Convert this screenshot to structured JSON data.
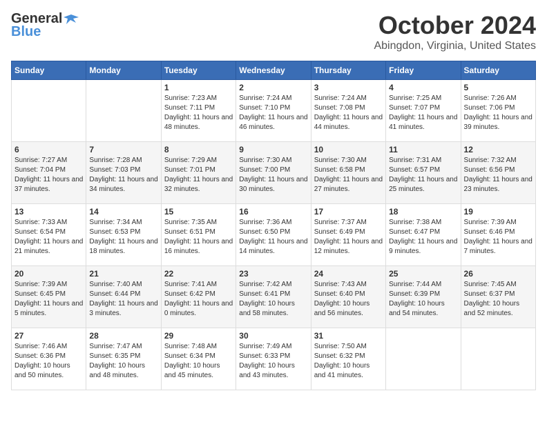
{
  "header": {
    "logo_general": "General",
    "logo_blue": "Blue",
    "month": "October 2024",
    "location": "Abingdon, Virginia, United States"
  },
  "weekdays": [
    "Sunday",
    "Monday",
    "Tuesday",
    "Wednesday",
    "Thursday",
    "Friday",
    "Saturday"
  ],
  "weeks": [
    [
      {
        "day": "",
        "info": ""
      },
      {
        "day": "",
        "info": ""
      },
      {
        "day": "1",
        "info": "Sunrise: 7:23 AM\nSunset: 7:11 PM\nDaylight: 11 hours and 48 minutes."
      },
      {
        "day": "2",
        "info": "Sunrise: 7:24 AM\nSunset: 7:10 PM\nDaylight: 11 hours and 46 minutes."
      },
      {
        "day": "3",
        "info": "Sunrise: 7:24 AM\nSunset: 7:08 PM\nDaylight: 11 hours and 44 minutes."
      },
      {
        "day": "4",
        "info": "Sunrise: 7:25 AM\nSunset: 7:07 PM\nDaylight: 11 hours and 41 minutes."
      },
      {
        "day": "5",
        "info": "Sunrise: 7:26 AM\nSunset: 7:06 PM\nDaylight: 11 hours and 39 minutes."
      }
    ],
    [
      {
        "day": "6",
        "info": "Sunrise: 7:27 AM\nSunset: 7:04 PM\nDaylight: 11 hours and 37 minutes."
      },
      {
        "day": "7",
        "info": "Sunrise: 7:28 AM\nSunset: 7:03 PM\nDaylight: 11 hours and 34 minutes."
      },
      {
        "day": "8",
        "info": "Sunrise: 7:29 AM\nSunset: 7:01 PM\nDaylight: 11 hours and 32 minutes."
      },
      {
        "day": "9",
        "info": "Sunrise: 7:30 AM\nSunset: 7:00 PM\nDaylight: 11 hours and 30 minutes."
      },
      {
        "day": "10",
        "info": "Sunrise: 7:30 AM\nSunset: 6:58 PM\nDaylight: 11 hours and 27 minutes."
      },
      {
        "day": "11",
        "info": "Sunrise: 7:31 AM\nSunset: 6:57 PM\nDaylight: 11 hours and 25 minutes."
      },
      {
        "day": "12",
        "info": "Sunrise: 7:32 AM\nSunset: 6:56 PM\nDaylight: 11 hours and 23 minutes."
      }
    ],
    [
      {
        "day": "13",
        "info": "Sunrise: 7:33 AM\nSunset: 6:54 PM\nDaylight: 11 hours and 21 minutes."
      },
      {
        "day": "14",
        "info": "Sunrise: 7:34 AM\nSunset: 6:53 PM\nDaylight: 11 hours and 18 minutes."
      },
      {
        "day": "15",
        "info": "Sunrise: 7:35 AM\nSunset: 6:51 PM\nDaylight: 11 hours and 16 minutes."
      },
      {
        "day": "16",
        "info": "Sunrise: 7:36 AM\nSunset: 6:50 PM\nDaylight: 11 hours and 14 minutes."
      },
      {
        "day": "17",
        "info": "Sunrise: 7:37 AM\nSunset: 6:49 PM\nDaylight: 11 hours and 12 minutes."
      },
      {
        "day": "18",
        "info": "Sunrise: 7:38 AM\nSunset: 6:47 PM\nDaylight: 11 hours and 9 minutes."
      },
      {
        "day": "19",
        "info": "Sunrise: 7:39 AM\nSunset: 6:46 PM\nDaylight: 11 hours and 7 minutes."
      }
    ],
    [
      {
        "day": "20",
        "info": "Sunrise: 7:39 AM\nSunset: 6:45 PM\nDaylight: 11 hours and 5 minutes."
      },
      {
        "day": "21",
        "info": "Sunrise: 7:40 AM\nSunset: 6:44 PM\nDaylight: 11 hours and 3 minutes."
      },
      {
        "day": "22",
        "info": "Sunrise: 7:41 AM\nSunset: 6:42 PM\nDaylight: 11 hours and 0 minutes."
      },
      {
        "day": "23",
        "info": "Sunrise: 7:42 AM\nSunset: 6:41 PM\nDaylight: 10 hours and 58 minutes."
      },
      {
        "day": "24",
        "info": "Sunrise: 7:43 AM\nSunset: 6:40 PM\nDaylight: 10 hours and 56 minutes."
      },
      {
        "day": "25",
        "info": "Sunrise: 7:44 AM\nSunset: 6:39 PM\nDaylight: 10 hours and 54 minutes."
      },
      {
        "day": "26",
        "info": "Sunrise: 7:45 AM\nSunset: 6:37 PM\nDaylight: 10 hours and 52 minutes."
      }
    ],
    [
      {
        "day": "27",
        "info": "Sunrise: 7:46 AM\nSunset: 6:36 PM\nDaylight: 10 hours and 50 minutes."
      },
      {
        "day": "28",
        "info": "Sunrise: 7:47 AM\nSunset: 6:35 PM\nDaylight: 10 hours and 48 minutes."
      },
      {
        "day": "29",
        "info": "Sunrise: 7:48 AM\nSunset: 6:34 PM\nDaylight: 10 hours and 45 minutes."
      },
      {
        "day": "30",
        "info": "Sunrise: 7:49 AM\nSunset: 6:33 PM\nDaylight: 10 hours and 43 minutes."
      },
      {
        "day": "31",
        "info": "Sunrise: 7:50 AM\nSunset: 6:32 PM\nDaylight: 10 hours and 41 minutes."
      },
      {
        "day": "",
        "info": ""
      },
      {
        "day": "",
        "info": ""
      }
    ]
  ]
}
